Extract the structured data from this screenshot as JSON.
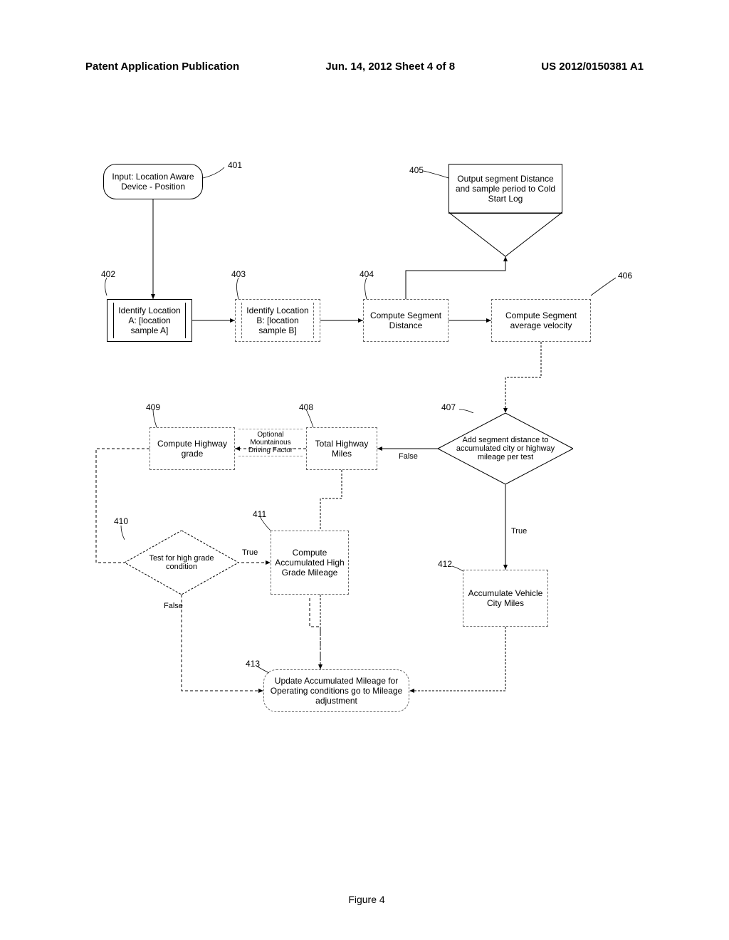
{
  "header": {
    "left": "Patent Application Publication",
    "center": "Jun. 14, 2012  Sheet 4 of 8",
    "right": "US 2012/0150381 A1"
  },
  "nodes": {
    "n401": "Input: Location Aware Device - Position",
    "n402": "Identify Location A: [location sample A]",
    "n403": "Identify Location B: [location sample B]",
    "n404": "Compute Segment Distance",
    "n405": "Output segment Distance and sample period to Cold Start Log",
    "n406": "Compute Segment average velocity",
    "n407": "Add segment distance to accumulated city or highway mileage per test",
    "n408": "Total Highway Miles",
    "n409": "Compute Highway grade",
    "n410": "Test for high grade condition",
    "n411": "Compute Accumulated High Grade Mileage",
    "n412": "Accumulate Vehicle City Miles",
    "n413": "Update Accumulated Mileage for Operating conditions go to Mileage adjustment"
  },
  "labels": {
    "l401": "401",
    "l402": "402",
    "l403": "403",
    "l404": "404",
    "l405": "405",
    "l406": "406",
    "l407": "407",
    "l408": "408",
    "l409": "409",
    "l410": "410",
    "l411": "411",
    "l412": "412",
    "l413": "413",
    "mountainous": "Optional Mountainous Driving Factor",
    "true1": "True",
    "false1": "False",
    "true2": "True",
    "false2": "False"
  },
  "caption": "Figure 4"
}
